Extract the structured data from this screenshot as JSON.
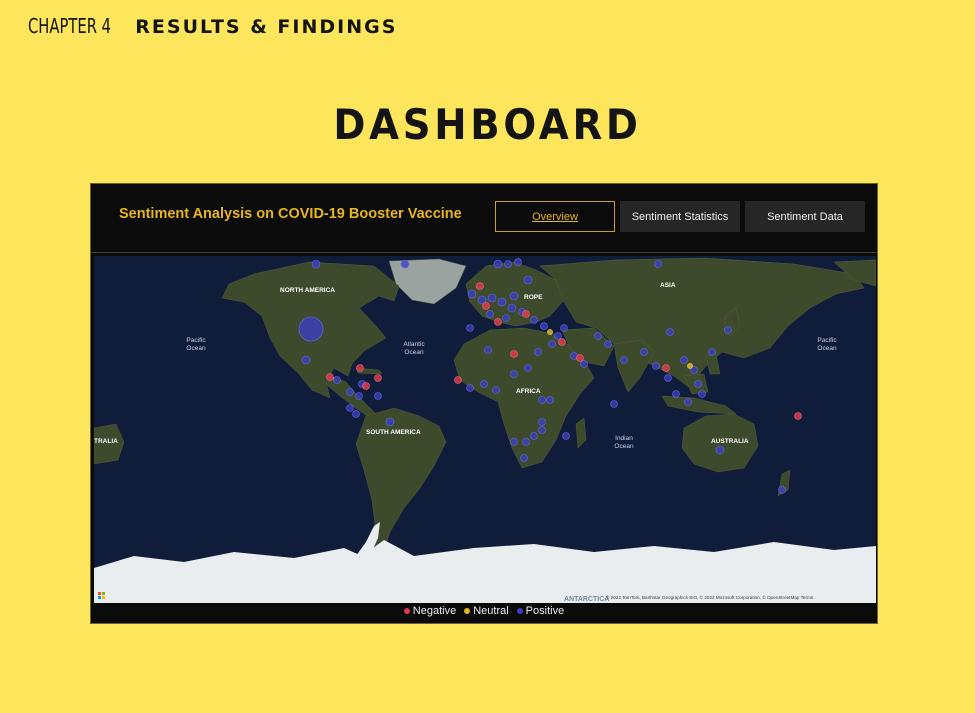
{
  "chapter": {
    "number": "CHAPTER 4",
    "title": "RESULTS & FINDINGS"
  },
  "page_title": "DASHBOARD",
  "dashboard": {
    "title": "Sentiment Analysis on COVID-19 Booster Vaccine",
    "nav": {
      "overview": "Overview",
      "statistics": "Sentiment Statistics",
      "data": "Sentiment Data"
    },
    "map": {
      "labels": {
        "north_america": "NORTH AMERICA",
        "south_america": "SOUTH AMERICA",
        "europe": "ROPE",
        "asia": "ASIA",
        "africa": "AFRICA",
        "australia": "AUSTRALIA",
        "australia_left": "TRALIA",
        "antarctica": "ANTARCTICA",
        "pacific_left_1": "Pacific",
        "pacific_left_2": "Ocean",
        "pacific_right_1": "Pacific",
        "pacific_right_2": "Ocean",
        "atlantic_1": "Atlantic",
        "atlantic_2": "Ocean",
        "indian_1": "Indian",
        "indian_2": "Ocean"
      },
      "attribution": "© 2022 TomTom, Barthstar Geographics SIO, © 2022 Microsoft Corporation, © OpenStreetMap  Terms",
      "colors": {
        "ocean": "#0d1a33",
        "land": "#3e4a2c",
        "ice": "#e9edf0",
        "negative": "#e0384a",
        "neutral": "#e3b51f",
        "positive": "#3b3fc4"
      }
    },
    "legend": [
      {
        "label": "Negative",
        "color": "#e0384a"
      },
      {
        "label": "Neutral",
        "color": "#e3b51f"
      },
      {
        "label": "Positive",
        "color": "#3b3fc4"
      }
    ]
  }
}
